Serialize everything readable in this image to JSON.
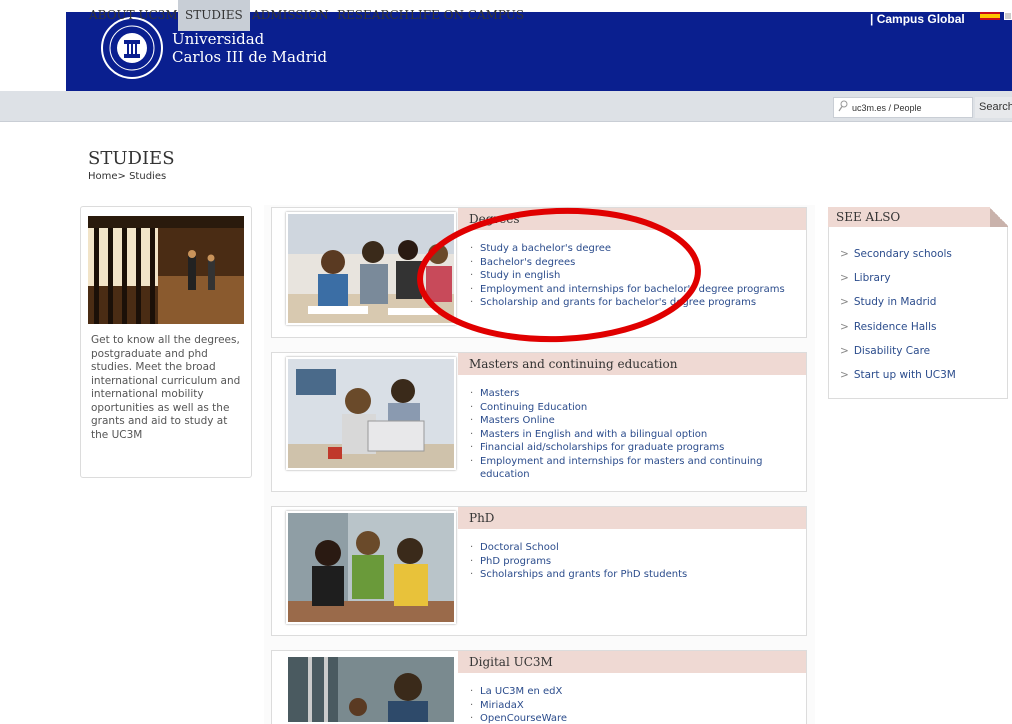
{
  "header": {
    "university_line1": "Universidad",
    "university_line2": "Carlos III de Madrid",
    "campus_global": "| Campus Global"
  },
  "nav": {
    "items": [
      {
        "label": "ABOUT UC3M"
      },
      {
        "label": "STUDIES"
      },
      {
        "label": "ADMISSION"
      },
      {
        "label": "RESEARCH"
      },
      {
        "label": "LIFE ON CAMPUS"
      }
    ],
    "active": "STUDIES"
  },
  "search": {
    "placeholder": "uc3m.es / People",
    "button_label": "Search"
  },
  "page": {
    "title": "STUDIES",
    "breadcrumb": "Home> Studies"
  },
  "intro": {
    "text": "Get to know all the degrees, postgraduate and phd studies. Meet the broad international curriculum and international mobility oportunities  as well as the grants and aid to study at the UC3M"
  },
  "cards": [
    {
      "title": "Degrees",
      "links": [
        "Study a bachelor's degree",
        "Bachelor's degrees",
        "Study in english",
        "Employment and internships for bachelor's degree programs",
        "Scholarship and grants for bachelor's degree programs"
      ]
    },
    {
      "title": "Masters and continuing education",
      "links": [
        "Masters",
        "Continuing Education",
        "Masters Online",
        "Masters in English and with a bilingual option",
        "Financial aid/scholarships for graduate programs",
        "Employment and internships for masters and continuing education"
      ]
    },
    {
      "title": "PhD",
      "links": [
        "Doctoral School",
        "PhD programs",
        "Scholarships and grants for PhD students"
      ]
    },
    {
      "title": "Digital UC3M",
      "links": [
        "La UC3M en edX",
        "MiriadaX",
        "OpenCourseWare"
      ]
    }
  ],
  "see_also": {
    "title": "SEE ALSO",
    "items": [
      "Secondary schools",
      "Library",
      "Study in Madrid",
      "Residence Halls",
      "Disability Care",
      "Start up with UC3M"
    ]
  },
  "colors": {
    "header_blue": "#0a1f8f",
    "nav_gray": "#dde1e6",
    "card_header": "#efd9d3",
    "link_blue": "#2b4c8c",
    "annotation_red": "#e00000"
  }
}
